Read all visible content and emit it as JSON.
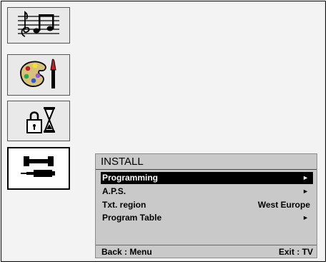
{
  "sidebar": {
    "items": [
      {
        "icon": "music-notes-icon",
        "selected": false
      },
      {
        "icon": "palette-brush-icon",
        "selected": false
      },
      {
        "icon": "lock-hourglass-icon",
        "selected": false
      },
      {
        "icon": "wrench-screwdriver-icon",
        "selected": true
      }
    ]
  },
  "menu": {
    "title": "INSTALL",
    "items": [
      {
        "label": "Programming",
        "value": "",
        "arrow": "►",
        "selected": true
      },
      {
        "label": "A.P.S.",
        "value": "",
        "arrow": "►",
        "selected": false
      },
      {
        "label": "Txt. region",
        "value": "West Europe",
        "arrow": "",
        "selected": false
      },
      {
        "label": "Program Table",
        "value": "",
        "arrow": "►",
        "selected": false
      }
    ],
    "footer": {
      "left": "Back : Menu",
      "right": "Exit : TV"
    }
  },
  "colors": {
    "background": "#f3f3f3",
    "menu_background": "#c9c9c9",
    "selected_row": "#000000",
    "palette_accent": "#d8c27a",
    "palette_red": "#c0202a",
    "palette_green": "#2aa84a",
    "palette_blue": "#2c5ad8"
  }
}
